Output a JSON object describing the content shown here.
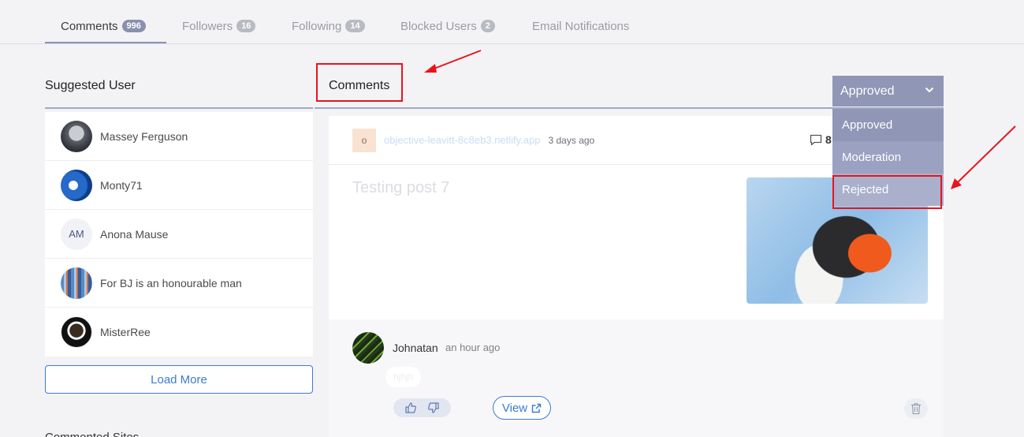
{
  "tabs": [
    {
      "label": "Comments",
      "count": "996"
    },
    {
      "label": "Followers",
      "count": "16"
    },
    {
      "label": "Following",
      "count": "14"
    },
    {
      "label": "Blocked Users",
      "count": "2"
    },
    {
      "label": "Email Notifications"
    }
  ],
  "sidebar": {
    "title": "Suggested User",
    "users": [
      {
        "name": "Massey Ferguson"
      },
      {
        "name": "Monty71"
      },
      {
        "name": "Anona Mause",
        "initials": "AM"
      },
      {
        "name": "For BJ is an honourable man"
      },
      {
        "name": "MisterRee"
      }
    ],
    "load_more": "Load More",
    "next_section_cut": "Commented Sites"
  },
  "main": {
    "title": "Comments",
    "post": {
      "site_icon_letter": "o",
      "site_url": "objective-leavitt-8c8eb3.netlify.app",
      "time": "3 days ago",
      "comment_count": "8",
      "title": "Testing post 7"
    },
    "reply": {
      "author": "Johnatan",
      "time": "an hour ago",
      "text": "hjhjh",
      "view_label": "View"
    }
  },
  "filter": {
    "selected": "Approved",
    "options": [
      "Approved",
      "Moderation",
      "Rejected"
    ]
  },
  "colors": {
    "accent": "#3b7bd1",
    "dropdown": "#8f96b6",
    "highlight": "#e8141c"
  }
}
